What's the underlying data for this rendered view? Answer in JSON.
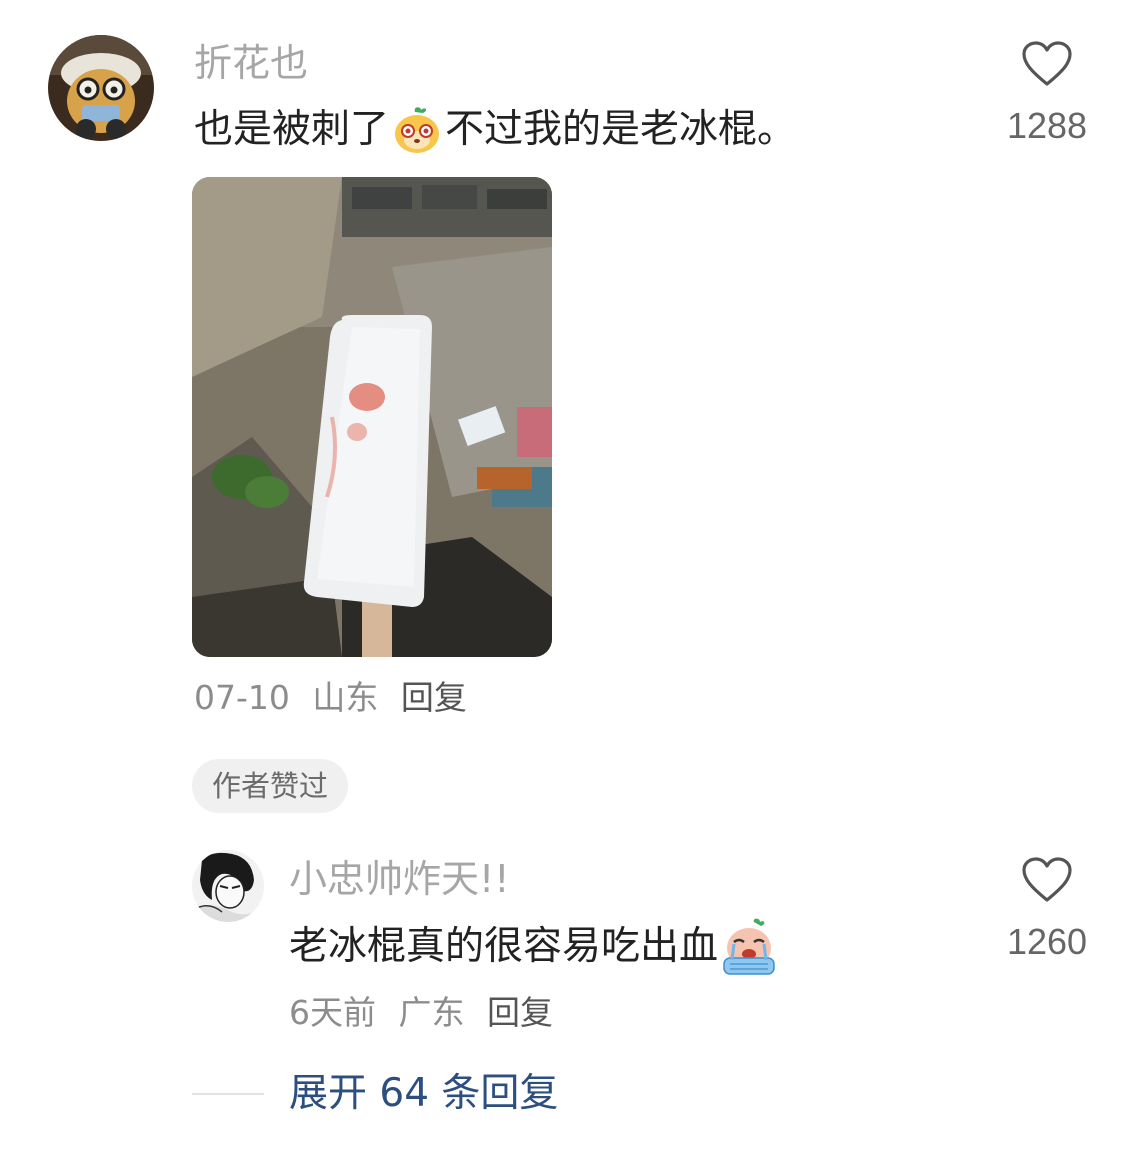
{
  "comment": {
    "username": "折花也",
    "text_before_emoji": "也是被刺了",
    "text_after_emoji": "不过我的是老冰棍。",
    "emoji_icon": "cute-face-emoji",
    "like_count": "1288",
    "date": "07-10",
    "location": "山东",
    "reply_label": "回复",
    "author_liked_badge": "作者赞过"
  },
  "reply": {
    "username": "小忠帅炸天!!",
    "text": "老冰棍真的很容易吃出血",
    "emoji_icon": "crying-face-emoji",
    "like_count": "1260",
    "date": "6天前",
    "location": "广东",
    "reply_label": "回复"
  },
  "expand": {
    "label": "展开 64 条回复"
  },
  "colors": {
    "username": "#a6a6a6",
    "body_text": "#222222",
    "meta": "#8c8c8c",
    "expand_link": "#2d4f7f",
    "badge_bg": "#f0f0f0"
  }
}
